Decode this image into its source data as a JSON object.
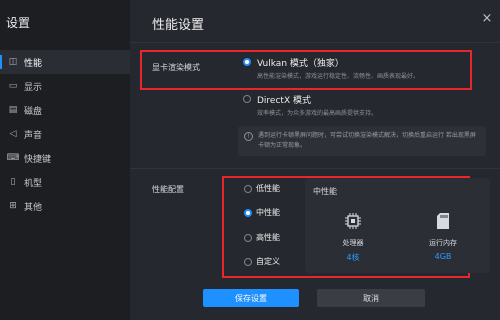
{
  "app": {
    "title": "设置",
    "close_glyph": "×"
  },
  "sidebar": {
    "items": [
      {
        "label": "性能",
        "icon": "gauge-icon",
        "glyph": "◫",
        "active": true
      },
      {
        "label": "显示",
        "icon": "monitor-icon",
        "glyph": "▭",
        "active": false
      },
      {
        "label": "磁盘",
        "icon": "disk-icon",
        "glyph": "▤",
        "active": false
      },
      {
        "label": "声音",
        "icon": "speaker-icon",
        "glyph": "◁",
        "active": false
      },
      {
        "label": "快捷键",
        "icon": "keyboard-icon",
        "glyph": "⌨",
        "active": false
      },
      {
        "label": "机型",
        "icon": "phone-icon",
        "glyph": "▯",
        "active": false
      },
      {
        "label": "其他",
        "icon": "grid-icon",
        "glyph": "⊞",
        "active": false
      }
    ]
  },
  "main": {
    "title": "性能设置",
    "render_mode": {
      "label": "显卡渲染模式",
      "options": [
        {
          "label": "Vulkan 模式（独家）",
          "desc": "高性能渲染模式，游戏运行稳定性、流畅性、画质表现最好。",
          "selected": true
        },
        {
          "label": "DirectX 模式",
          "desc": "效率模式，为众多游戏的最高画质提供支持。",
          "selected": false
        }
      ],
      "notice": "遇到运行卡顿黑屏问题时，可尝试切换渲染模式解决，切换后重启运行 若出现黑屏卡顿为正常现象。"
    },
    "performance": {
      "label": "性能配置",
      "options": [
        {
          "label": "低性能",
          "selected": false
        },
        {
          "label": "中性能",
          "selected": true
        },
        {
          "label": "高性能",
          "selected": false
        },
        {
          "label": "自定义",
          "selected": false
        }
      ],
      "card": {
        "title": "中性能",
        "specs": [
          {
            "label": "处理器",
            "value": "4核",
            "icon": "cpu-icon"
          },
          {
            "label": "运行内存",
            "value": "4GB",
            "icon": "memory-card-icon"
          }
        ]
      }
    },
    "buttons": {
      "save": "保存设置",
      "cancel": "取消"
    }
  },
  "colors": {
    "accent": "#1e90ff",
    "highlight_box": "#e8262b",
    "value_text": "#2c9bff"
  }
}
